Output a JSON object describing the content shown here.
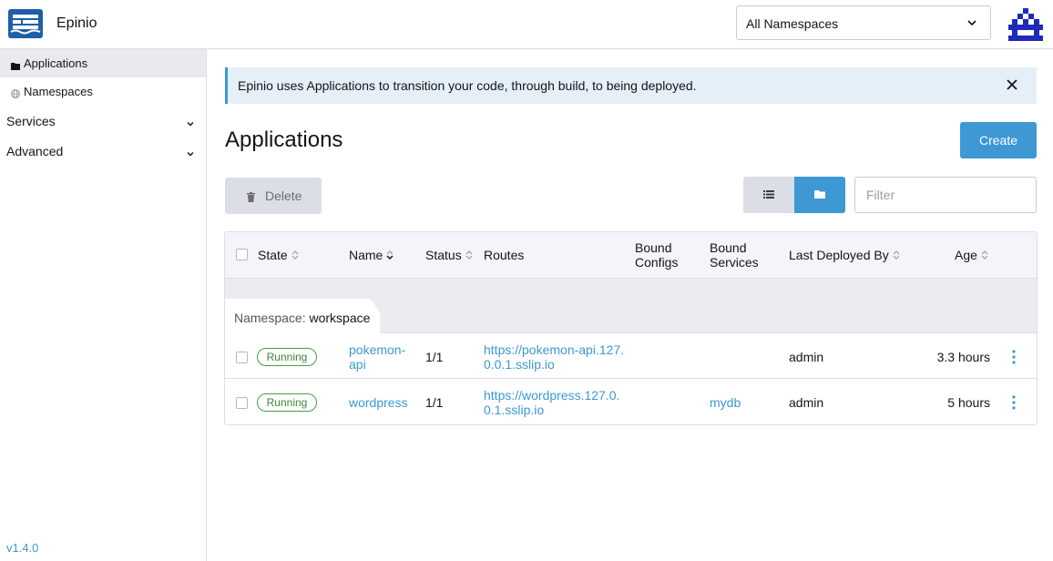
{
  "header": {
    "app_title": "Epinio",
    "namespace_select": {
      "value": "All Namespaces"
    },
    "logo_icon": "epinio-ship-icon",
    "avatar_icon": "user-avatar-identicon"
  },
  "sidebar": {
    "items": [
      {
        "label": "Applications",
        "icon": "folder-icon",
        "active": true
      },
      {
        "label": "Namespaces",
        "icon": "globe-icon",
        "active": false
      }
    ],
    "groups": [
      {
        "label": "Services"
      },
      {
        "label": "Advanced"
      }
    ],
    "version": "v1.4.0"
  },
  "banner": {
    "text": "Epinio uses Applications to transition your code, through build, to being deployed."
  },
  "page": {
    "title": "Applications",
    "create_label": "Create",
    "delete_label": "Delete",
    "filter_placeholder": "Filter"
  },
  "table": {
    "headers": {
      "state": "State",
      "name": "Name",
      "status": "Status",
      "routes": "Routes",
      "bound_configs_1": "Bound",
      "bound_configs_2": "Configs",
      "bound_services_1": "Bound",
      "bound_services_2": "Services",
      "last_deployed_by": "Last Deployed By",
      "age": "Age"
    },
    "group": {
      "key": "Namespace:",
      "value": "workspace"
    },
    "rows": [
      {
        "state": "Running",
        "name_1": "pokemon-",
        "name_2": "api",
        "status": "1/1",
        "route_1": "https://pokemon-api.127.",
        "route_2": "0.0.1.sslip.io",
        "bound_configs": "",
        "bound_services": "",
        "last_deployed_by": "admin",
        "age": "3.3 hours"
      },
      {
        "state": "Running",
        "name_1": "wordpress",
        "name_2": "",
        "status": "1/1",
        "route_1": "https://wordpress.127.0.",
        "route_2": "0.1.sslip.io",
        "bound_configs": "",
        "bound_services": "mydb",
        "last_deployed_by": "admin",
        "age": "5 hours"
      }
    ]
  },
  "colors": {
    "accent": "#3d98d3",
    "running": "#3a883a",
    "banner_bg": "#e4eff8"
  }
}
